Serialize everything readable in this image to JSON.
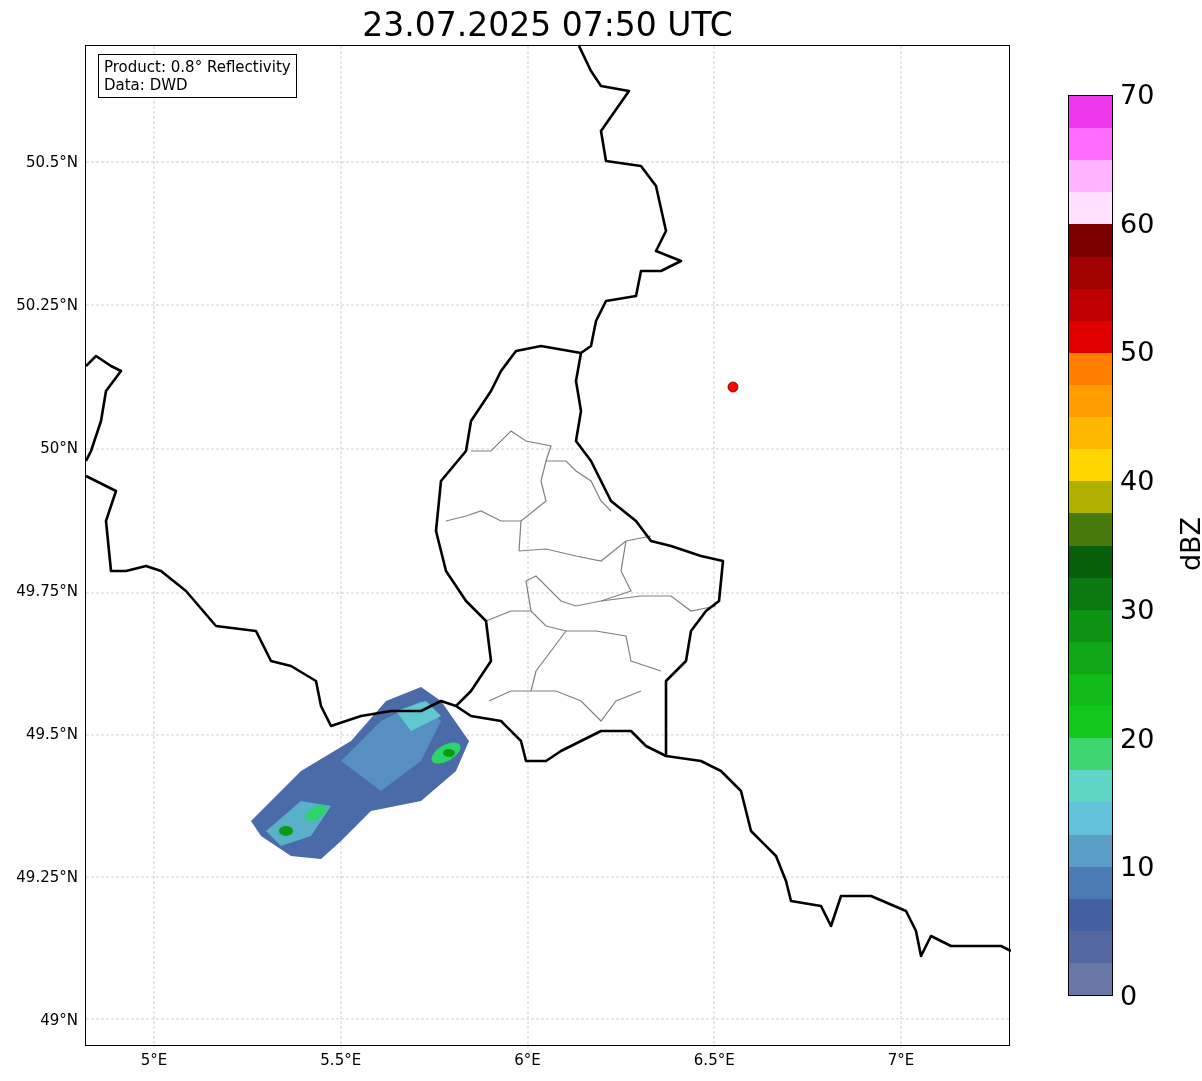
{
  "title": "23.07.2025 07:50 UTC",
  "legend": [
    "Product: 0.8° Reflectivity",
    "Data: DWD"
  ],
  "x_ticks": [
    "5°E",
    "5.5°E",
    "6°E",
    "6.5°E",
    "7°E"
  ],
  "y_ticks": [
    "50.5°N",
    "50.25°N",
    "50°N",
    "49.75°N",
    "49.5°N",
    "49.25°N",
    "49°N"
  ],
  "colorbar": {
    "label": "dBZ",
    "ticks": [
      "70",
      "60",
      "50",
      "40",
      "30",
      "20",
      "10",
      "0"
    ],
    "bands": [
      {
        "color": "#ee38ee"
      },
      {
        "color": "#ff6cff"
      },
      {
        "color": "#ffb2ff"
      },
      {
        "color": "#ffe0ff"
      },
      {
        "color": "#7d0000"
      },
      {
        "color": "#a00000"
      },
      {
        "color": "#c00000"
      },
      {
        "color": "#e00000"
      },
      {
        "color": "#ff7e00"
      },
      {
        "color": "#ff9c00"
      },
      {
        "color": "#ffb800"
      },
      {
        "color": "#ffd700"
      },
      {
        "color": "#b0b000"
      },
      {
        "color": "#477a0b"
      },
      {
        "color": "#075f0b"
      },
      {
        "color": "#0a7a10"
      },
      {
        "color": "#0d9214"
      },
      {
        "color": "#0fa716"
      },
      {
        "color": "#10bb1a"
      },
      {
        "color": "#12c81a"
      },
      {
        "color": "#3dd570"
      },
      {
        "color": "#5fd6c5"
      },
      {
        "color": "#64c1da"
      },
      {
        "color": "#5b9fc8"
      },
      {
        "color": "#4a7bb2"
      },
      {
        "color": "#4560a0"
      },
      {
        "color": "#5567a0"
      },
      {
        "color": "#6877a6"
      }
    ]
  }
}
